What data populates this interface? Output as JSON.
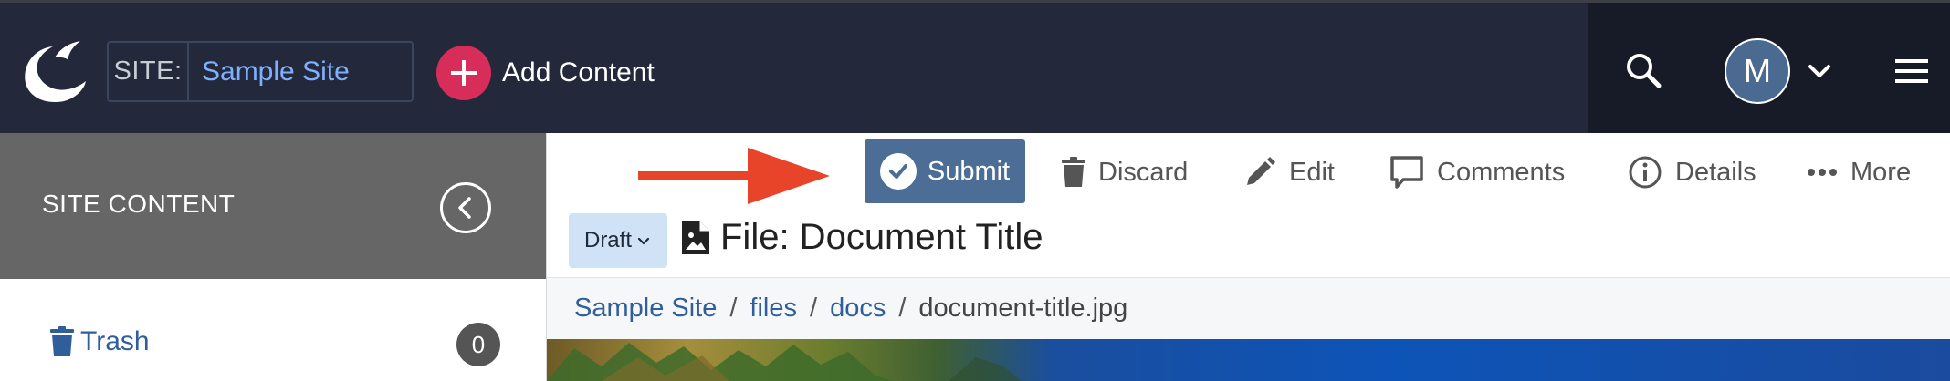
{
  "header": {
    "site_label": "SITE:",
    "site_name": "Sample Site",
    "add_content_label": "Add Content",
    "avatar_initial": "M"
  },
  "sidebar": {
    "title": "SITE CONTENT",
    "trash_label": "Trash",
    "trash_count": "0"
  },
  "toolbar": {
    "submit_label": "Submit",
    "discard_label": "Discard",
    "edit_label": "Edit",
    "comments_label": "Comments",
    "details_label": "Details",
    "more_label": "More"
  },
  "document": {
    "status": "Draft",
    "title": "File: Document Title"
  },
  "breadcrumb": {
    "items": [
      "Sample Site",
      "files",
      "docs"
    ],
    "current": "document-title.jpg",
    "separator": "/"
  },
  "colors": {
    "topbar": "#23283a",
    "accent_add": "#d62d5a",
    "submit": "#4b6d96",
    "link": "#305e9b",
    "arrow": "#e8442a"
  }
}
